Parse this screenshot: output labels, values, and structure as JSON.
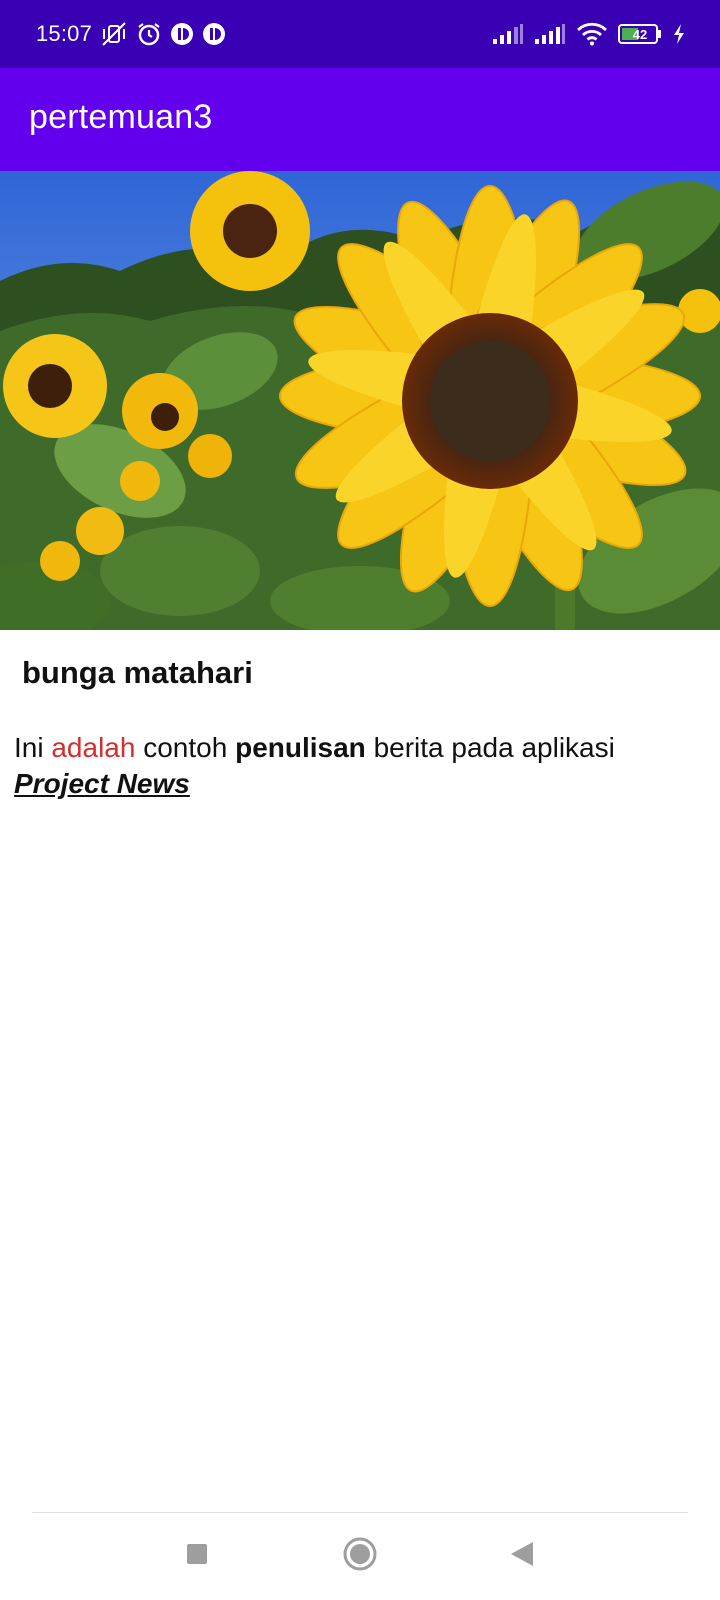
{
  "status_bar": {
    "time": "15:07",
    "battery_level": "42",
    "icons": [
      "vibrate-off-icon",
      "alarm-icon",
      "app-notification-icon",
      "app-notification-icon",
      "signal-icon",
      "signal-icon",
      "wifi-icon",
      "battery-icon",
      "charging-icon"
    ],
    "background": "#3a00b3"
  },
  "app_bar": {
    "title": "pertemuan3",
    "background": "#6200ee"
  },
  "article": {
    "image_icon": "sunflower-image",
    "title": "bunga matahari",
    "body": {
      "part1": "Ini ",
      "part2_red": "adalah",
      "part3": " contoh ",
      "part4_bold": "penulisan",
      "part5": " berita pada aplikasi ",
      "part6_brand": "Project News"
    },
    "accent_red": "#d32f2f"
  },
  "nav_bar": {
    "buttons": [
      "recents-icon",
      "home-icon",
      "back-icon"
    ]
  }
}
